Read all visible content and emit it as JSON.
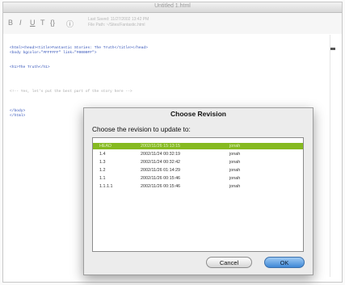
{
  "window": {
    "title": "Untitled 1.html"
  },
  "toolbar": {
    "buttons": [
      "B",
      "I",
      "U",
      "T",
      "{}"
    ],
    "info_lines": [
      "Last Saved: 11/27/2002 13:42 PM",
      "File Path: ~/Sites/Fantastic.html"
    ]
  },
  "editor": {
    "lines": [
      {
        "text": "<html><head><title>Fantastic Stories: The Truth</title></head>",
        "color": "#3050b8"
      },
      {
        "text": "<body bgcolor=\"#FFFFFF\" link=\"#0000FF\">",
        "color": "#3050b8"
      },
      {
        "text": "<h1>The Truth</h1>",
        "color": "#3050b8"
      },
      {
        "text": "<!-- Yes, let's put the best part of the story here -->",
        "color": "#a8a8a8"
      },
      {
        "text": "</body>",
        "color": "#3050b8"
      },
      {
        "text": "</html>",
        "color": "#3050b8"
      }
    ]
  },
  "dialog": {
    "title": "Choose Revision",
    "prompt": "Choose the revision to update to:",
    "selected_color": "#86ba21",
    "revisions": [
      {
        "rev": "HEAD",
        "date": "2002/11/26 15:13:15",
        "author": "jonah",
        "selected": true
      },
      {
        "rev": "1.4",
        "date": "2002/11/24 00:32:19",
        "author": "jonah",
        "selected": false
      },
      {
        "rev": "1.3",
        "date": "2002/11/24 00:32:42",
        "author": "jonah",
        "selected": false
      },
      {
        "rev": "1.2",
        "date": "2002/11/26 01:14:29",
        "author": "jonah",
        "selected": false
      },
      {
        "rev": "1.1",
        "date": "2002/11/26 00:15:46",
        "author": "jonah",
        "selected": false
      },
      {
        "rev": "1.1.1.1",
        "date": "2002/11/26 00:15:46",
        "author": "jonah",
        "selected": false
      }
    ],
    "cancel_label": "Cancel",
    "ok_label": "OK"
  }
}
